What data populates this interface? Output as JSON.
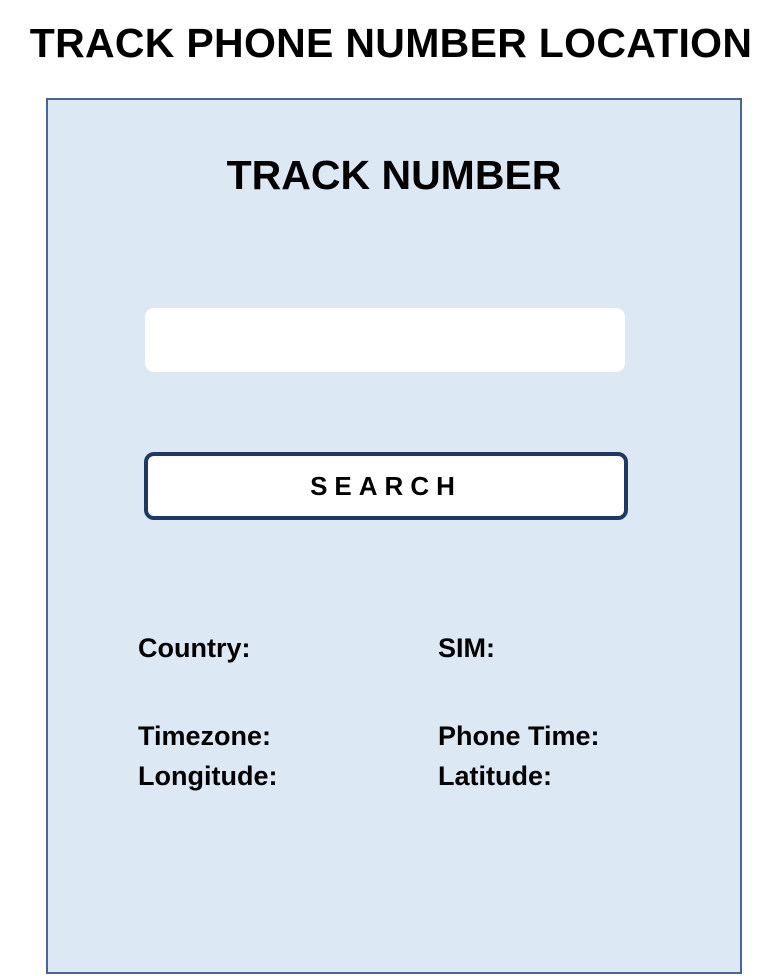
{
  "page_title": "TRACK PHONE NUMBER LOCATION",
  "panel": {
    "title": "TRACK NUMBER",
    "search_input": {
      "value": "",
      "placeholder": ""
    },
    "search_button_label": "SEARCH",
    "fields": {
      "country": "Country:",
      "sim": "SIM:",
      "timezone": "Timezone:",
      "phone_time": "Phone Time:",
      "longitude": "Longitude:",
      "latitude": "Latitude:"
    }
  },
  "colors": {
    "panel_background": "#dde8f5",
    "panel_border": "#4a6590",
    "button_border": "#203864"
  }
}
